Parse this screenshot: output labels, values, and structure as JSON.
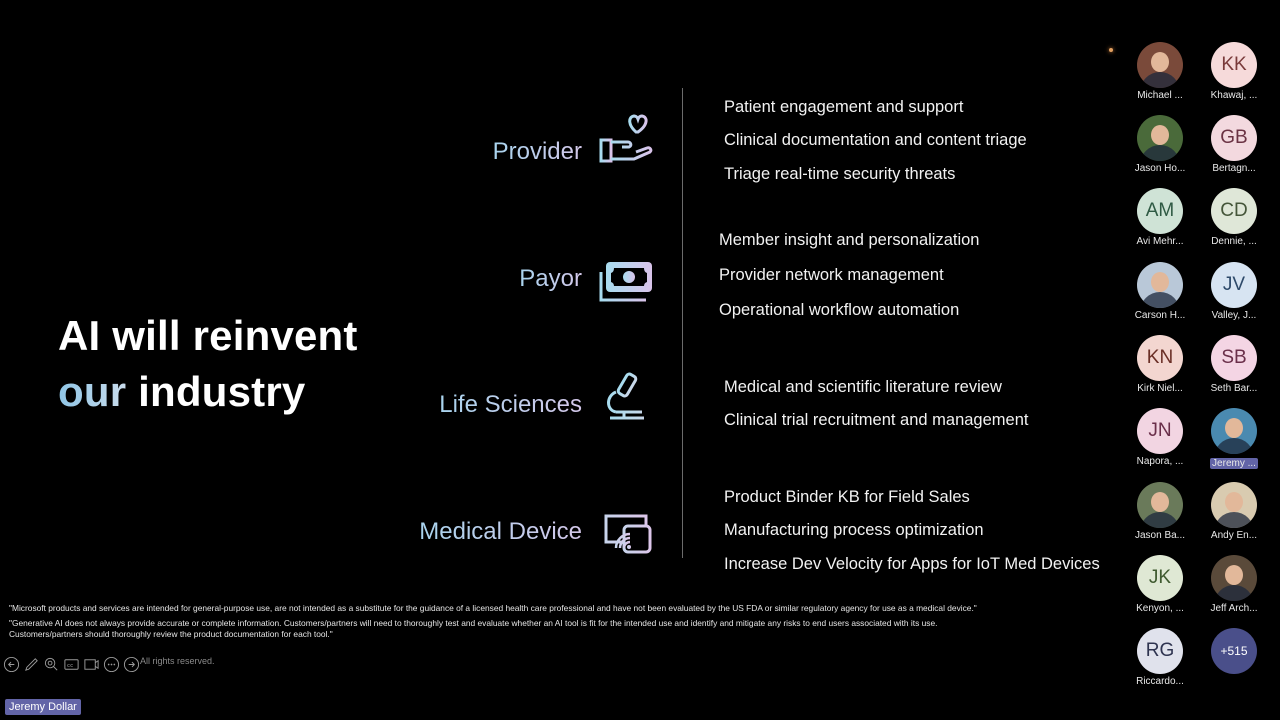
{
  "slide": {
    "headline_line1": "AI will reinvent",
    "headline_accent": "our",
    "headline_rest": " industry",
    "sectors": [
      {
        "label": "Provider",
        "icon": "hand-heart-icon",
        "items": [
          "Patient engagement and support",
          "Clinical documentation and content triage",
          "Triage real-time security threats"
        ]
      },
      {
        "label": "Payor",
        "icon": "money-bill-icon",
        "items": [
          "Member insight and personalization",
          "Provider network management",
          "Operational workflow automation"
        ]
      },
      {
        "label": "Life Sciences",
        "icon": "microscope-icon",
        "items": [
          "Medical and scientific literature review",
          "Clinical trial recruitment and management"
        ]
      },
      {
        "label": "Medical Device",
        "icon": "connected-device-icon",
        "items": [
          "Product Binder KB for Field Sales",
          "Manufacturing process optimization",
          "Increase Dev Velocity for Apps for IoT Med Devices"
        ]
      }
    ],
    "disclaimers": [
      "\"Microsoft products and services are intended for general-purpose use, are not intended as a substitute for the guidance of a licensed health care professional and have not been evaluated by the US FDA or similar regulatory agency for use as a medical device.\"",
      "\"Generative AI does not always provide accurate or complete information. Customers/partners will need to thoroughly test and evaluate whether an AI tool is fit for the intended use and identify and mitigate any risks to end users associated with its use.",
      "Customers/partners should thoroughly review the product documentation for each tool.\""
    ],
    "copyright": "All rights reserved."
  },
  "controls": [
    "previous-icon",
    "pen-icon",
    "zoom-icon",
    "captions-icon",
    "screen-icon",
    "more-icon",
    "next-icon"
  ],
  "presenter_label": "Jeremy Dollar",
  "participants": [
    {
      "name": "Michael ...",
      "initials": "",
      "photo": true,
      "bg": "#7a4a3a"
    },
    {
      "name": "Khawaj, ...",
      "initials": "KK",
      "bg": "#f6dada",
      "fg": "#7a3b3b"
    },
    {
      "name": "Jason Ho...",
      "initials": "",
      "photo": true,
      "bg": "#4a6a3a"
    },
    {
      "name": "Bertagn...",
      "initials": "GB",
      "bg": "#f3d9df",
      "fg": "#6b3344"
    },
    {
      "name": "Avi Mehr...",
      "initials": "AM",
      "bg": "#cfe3d6",
      "fg": "#2f5a44"
    },
    {
      "name": "Dennie, ...",
      "initials": "CD",
      "bg": "#dfe7d8",
      "fg": "#45563a"
    },
    {
      "name": "Carson H...",
      "initials": "",
      "photo": true,
      "bg": "#b9c8d8"
    },
    {
      "name": "Valley, J...",
      "initials": "JV",
      "bg": "#d7e4f2",
      "fg": "#2e4a6a"
    },
    {
      "name": "Kirk Niel...",
      "initials": "KN",
      "bg": "#f3d6d0",
      "fg": "#6a2f26"
    },
    {
      "name": "Seth Bar...",
      "initials": "SB",
      "bg": "#f4d5e4",
      "fg": "#6a2f4a"
    },
    {
      "name": "Napora, ...",
      "initials": "JN",
      "bg": "#f2d5e2",
      "fg": "#6a2f4a"
    },
    {
      "name": "Jeremy ...",
      "initials": "",
      "photo": true,
      "bg": "#4a8ab0",
      "highlight": true
    },
    {
      "name": "Jason Ba...",
      "initials": "",
      "photo": true,
      "bg": "#6a7a5a"
    },
    {
      "name": "Andy En...",
      "initials": "",
      "photo": true,
      "bg": "#d9cbb0"
    },
    {
      "name": "Kenyon, ...",
      "initials": "JK",
      "bg": "#dfe8d4",
      "fg": "#3f5a2f"
    },
    {
      "name": "Jeff Arch...",
      "initials": "",
      "photo": true,
      "bg": "#5a4a3a"
    },
    {
      "name": "Riccardo...",
      "initials": "RG",
      "bg": "#e0e2ec",
      "fg": "#2f3450"
    },
    {
      "name": "",
      "initials": "+515",
      "bg": "#4a4f8a",
      "fg": "#ffffff",
      "overflow": true
    }
  ]
}
